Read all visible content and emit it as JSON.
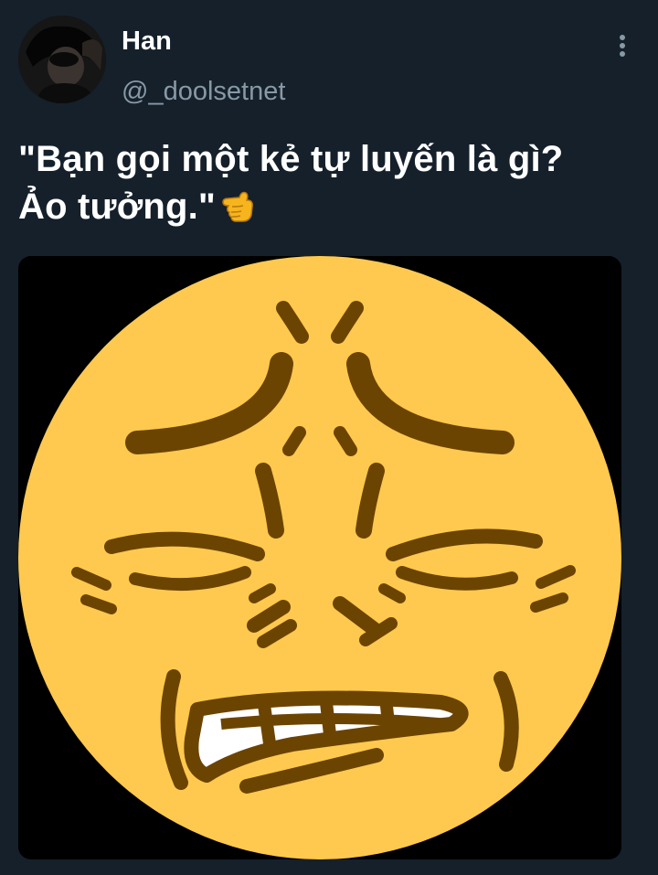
{
  "author": {
    "name": "Han",
    "handle": "@_doolsetnet"
  },
  "tweet": {
    "line1": "\"Bạn gọi một kẻ tự luyến là gì?",
    "line2": "Ảo tưởng.\"",
    "emoji": "hand-pointing-left-emoji"
  },
  "media": {
    "subject": "disgusted-face-emoji-image"
  },
  "colors": {
    "background": "#15202b",
    "text": "#ffffff",
    "secondary_text": "#8899a6",
    "face_yellow": "#fec94e",
    "face_features": "#6c4402"
  }
}
